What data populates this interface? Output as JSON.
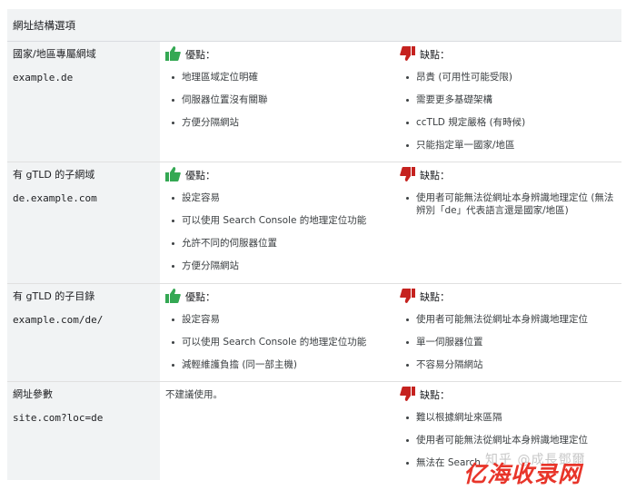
{
  "header": {
    "title": "網址結構選項"
  },
  "labels": {
    "pros": "優點：",
    "cons": "缺點："
  },
  "colors": {
    "pros": "#34a853",
    "cons": "#c5221f"
  },
  "rows": [
    {
      "option": "國家/地區專屬網域",
      "example": "example.de",
      "pros": [
        "地理區域定位明確",
        "伺服器位置沒有關聯",
        "方便分隔網站"
      ],
      "cons": [
        "昂貴 (可用性可能受限)",
        "需要更多基礎架構",
        "ccTLD 規定嚴格 (有時候)",
        "只能指定單一國家/地區"
      ]
    },
    {
      "option": "有 gTLD 的子網域",
      "example": "de.example.com",
      "pros": [
        "設定容易",
        "可以使用 Search Console 的地理定位功能",
        "允許不同的伺服器位置",
        "方便分隔網站"
      ],
      "cons": [
        "使用者可能無法從網址本身辨識地理定位 (無法辨別「de」代表語言還是國家/地區)"
      ]
    },
    {
      "option": "有 gTLD 的子目錄",
      "example": "example.com/de/",
      "pros": [
        "設定容易",
        "可以使用 Search Console 的地理定位功能",
        "減輕維護負擔 (同一部主機)"
      ],
      "cons": [
        "使用者可能無法從網址本身辨識地理定位",
        "單一伺服器位置",
        "不容易分隔網站"
      ]
    },
    {
      "option": "網址參數",
      "example": "site.com?loc=de",
      "pros_text": "不建議使用。",
      "cons": [
        "難以根據網址來區隔",
        "使用者可能無法從網址本身辨識地理定位",
        "無法在 Search"
      ]
    }
  ],
  "watermark": {
    "top": "知乎 @成長鄧爾",
    "brand": "亿海收录网"
  }
}
